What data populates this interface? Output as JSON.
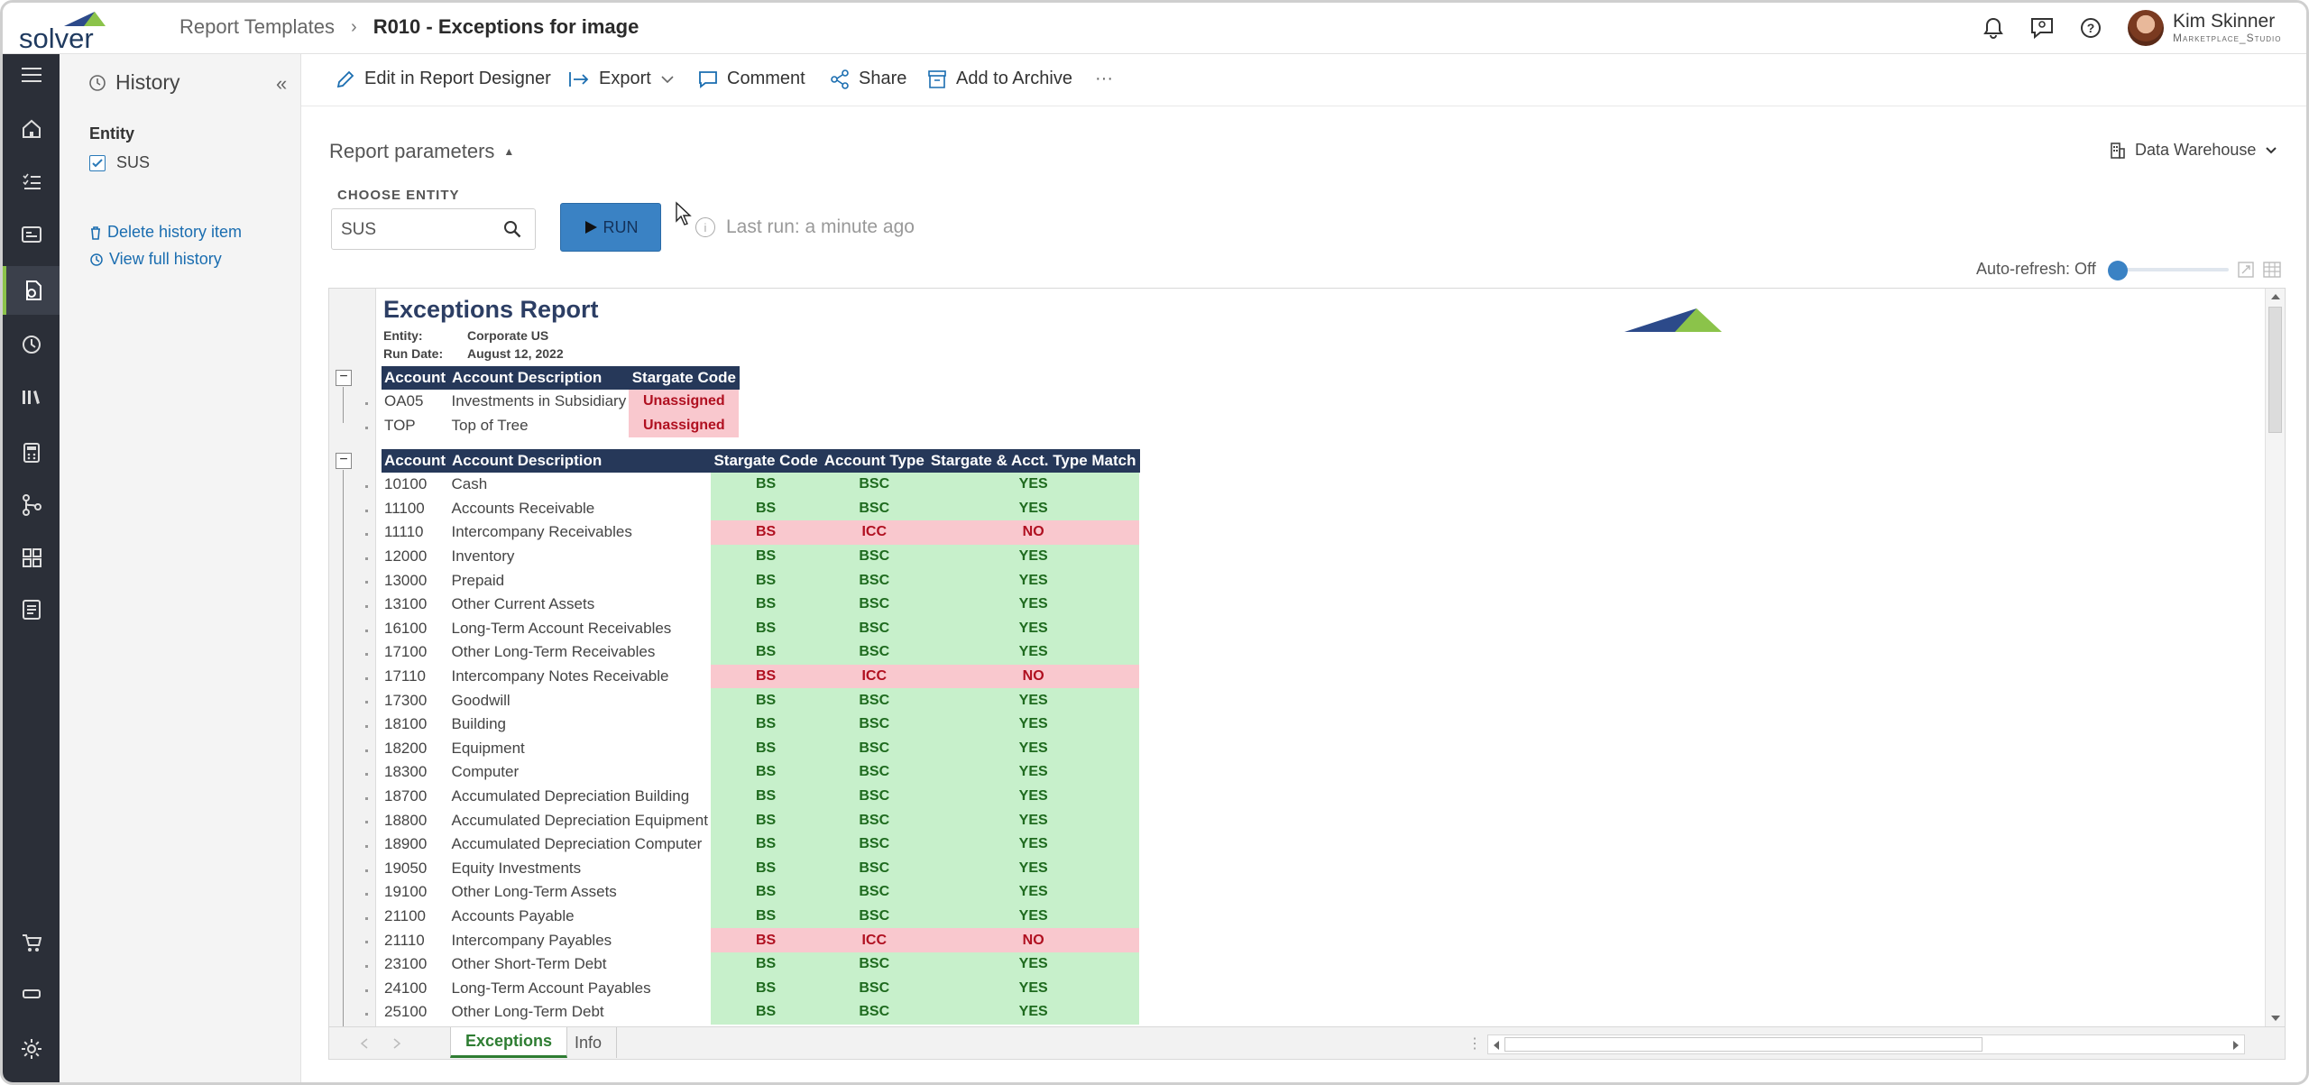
{
  "app": {
    "logo_text": "solver"
  },
  "breadcrumb": {
    "parent": "Report Templates",
    "current": "R010 - Exceptions for image"
  },
  "user": {
    "name": "Kim Skinner",
    "org": "Marketplace_Studio"
  },
  "history": {
    "title": "History",
    "entity_label": "Entity",
    "entity_value": "SUS",
    "delete_link": "Delete history item",
    "view_link": "View full history"
  },
  "toolbar": {
    "edit": "Edit in Report Designer",
    "export": "Export",
    "comment": "Comment",
    "share": "Share",
    "archive": "Add to Archive",
    "more": "···"
  },
  "params": {
    "title": "Report parameters",
    "choose_label": "CHOOSE ENTITY",
    "entity_value": "SUS",
    "run_label": "RUN",
    "last_run": "Last run: a minute ago",
    "data_source": "Data Warehouse",
    "auto_refresh": "Auto-refresh: Off"
  },
  "report": {
    "title": "Exceptions Report",
    "entity_label": "Entity:",
    "entity_value": "Corporate US",
    "run_date_label": "Run Date:",
    "run_date_value": "August 12, 2022",
    "table1": {
      "headers": [
        "Account",
        "Account Description",
        "Stargate Code"
      ],
      "rows": [
        [
          "OA05",
          "Investments in Subsidiary",
          "Unassigned"
        ],
        [
          "TOP",
          "Top of Tree",
          "Unassigned"
        ]
      ]
    },
    "table2": {
      "headers": [
        "Account",
        "Account Description",
        "Stargate Code",
        "Account Type",
        "Stargate & Acct. Type Match"
      ],
      "rows": [
        [
          "10100",
          "Cash",
          "BS",
          "BSC",
          "YES"
        ],
        [
          "11100",
          "Accounts Receivable",
          "BS",
          "BSC",
          "YES"
        ],
        [
          "11110",
          "Intercompany Receivables",
          "BS",
          "ICC",
          "NO"
        ],
        [
          "12000",
          "Inventory",
          "BS",
          "BSC",
          "YES"
        ],
        [
          "13000",
          "Prepaid",
          "BS",
          "BSC",
          "YES"
        ],
        [
          "13100",
          "Other Current Assets",
          "BS",
          "BSC",
          "YES"
        ],
        [
          "16100",
          "Long-Term Account Receivables",
          "BS",
          "BSC",
          "YES"
        ],
        [
          "17100",
          "Other Long-Term Receivables",
          "BS",
          "BSC",
          "YES"
        ],
        [
          "17110",
          "Intercompany Notes Receivable",
          "BS",
          "ICC",
          "NO"
        ],
        [
          "17300",
          "Goodwill",
          "BS",
          "BSC",
          "YES"
        ],
        [
          "18100",
          "Building",
          "BS",
          "BSC",
          "YES"
        ],
        [
          "18200",
          "Equipment",
          "BS",
          "BSC",
          "YES"
        ],
        [
          "18300",
          "Computer",
          "BS",
          "BSC",
          "YES"
        ],
        [
          "18700",
          "Accumulated Depreciation Building",
          "BS",
          "BSC",
          "YES"
        ],
        [
          "18800",
          "Accumulated Depreciation Equipment",
          "BS",
          "BSC",
          "YES"
        ],
        [
          "18900",
          "Accumulated Depreciation Computer",
          "BS",
          "BSC",
          "YES"
        ],
        [
          "19050",
          "Equity Investments",
          "BS",
          "BSC",
          "YES"
        ],
        [
          "19100",
          "Other Long-Term Assets",
          "BS",
          "BSC",
          "YES"
        ],
        [
          "21100",
          "Accounts Payable",
          "BS",
          "BSC",
          "YES"
        ],
        [
          "21110",
          "Intercompany Payables",
          "BS",
          "ICC",
          "NO"
        ],
        [
          "23100",
          "Other Short-Term Debt",
          "BS",
          "BSC",
          "YES"
        ],
        [
          "24100",
          "Long-Term Account Payables",
          "BS",
          "BSC",
          "YES"
        ],
        [
          "25100",
          "Other Long-Term Debt",
          "BS",
          "BSC",
          "YES"
        ]
      ]
    }
  },
  "sheet_tabs": [
    "Exceptions",
    "Info"
  ],
  "colors": {
    "accent": "#3a82c4",
    "header": "#263859",
    "match_bg": "#c7f0cb",
    "mismatch_bg": "#f9c8ce",
    "rail": "#2b2f38"
  }
}
